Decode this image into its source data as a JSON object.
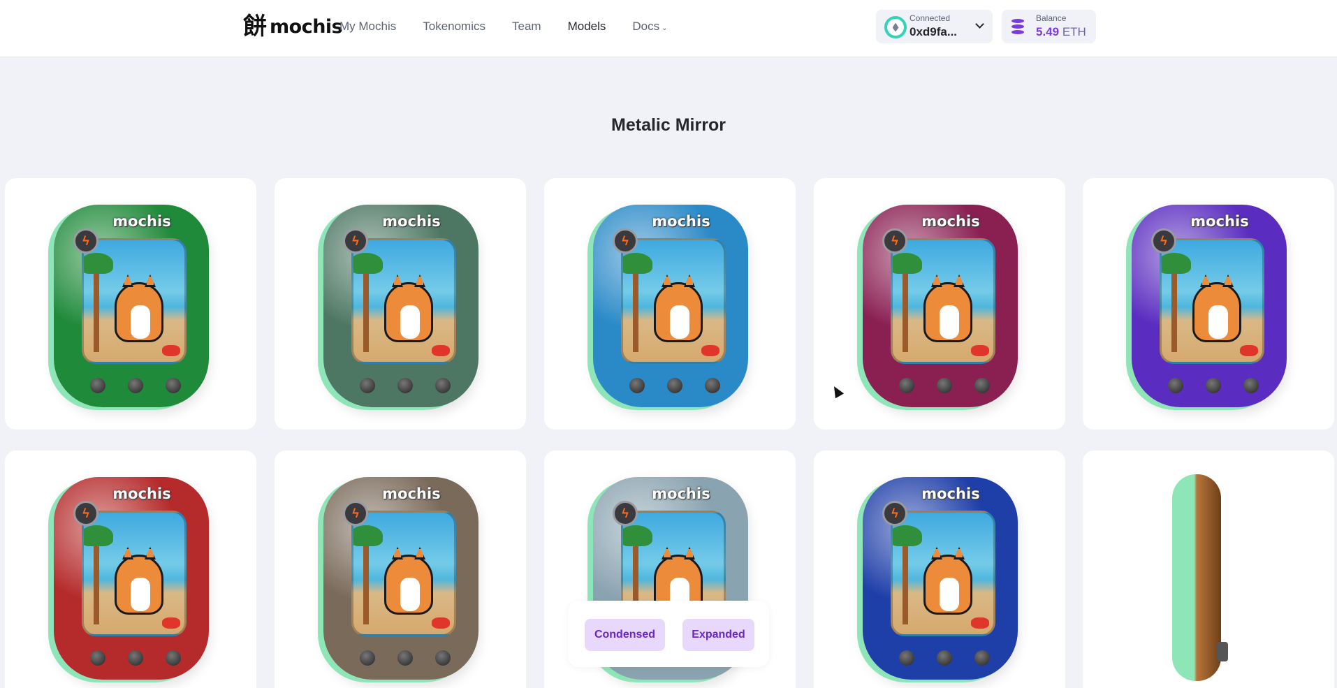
{
  "header": {
    "logo_glyph": "餅",
    "logo_text": "mochis",
    "nav": [
      {
        "label": "My Mochis"
      },
      {
        "label": "Tokenomics"
      },
      {
        "label": "Team"
      },
      {
        "label": "Models"
      },
      {
        "label": "Docs"
      }
    ],
    "wallet": {
      "status": "Connected",
      "address": "0xd9fa...",
      "icon": "ethereum-icon"
    },
    "balance": {
      "label": "Balance",
      "value": "5.49",
      "unit": "ETH",
      "icon": "coins-icon"
    }
  },
  "page": {
    "title": "Metalic Mirror"
  },
  "models": [
    {
      "brand": "mochis",
      "color": "#1f8a3a"
    },
    {
      "brand": "mochis",
      "color": "#4d7763"
    },
    {
      "brand": "mochis",
      "color": "#2a8ac8"
    },
    {
      "brand": "mochis",
      "color": "#8a1f52"
    },
    {
      "brand": "mochis",
      "color": "#5a2cc0"
    },
    {
      "brand": "mochis",
      "color": "#b52a2a"
    },
    {
      "brand": "mochis",
      "color": "#7a6a5a"
    },
    {
      "brand": "mochis",
      "color": "#8aa3b0"
    },
    {
      "brand": "mochis",
      "color": "#1f3fa8"
    },
    {
      "brand": "",
      "color": "#b8763a"
    }
  ],
  "view_toggle": {
    "condensed": "Condensed",
    "expanded": "Expanded"
  }
}
